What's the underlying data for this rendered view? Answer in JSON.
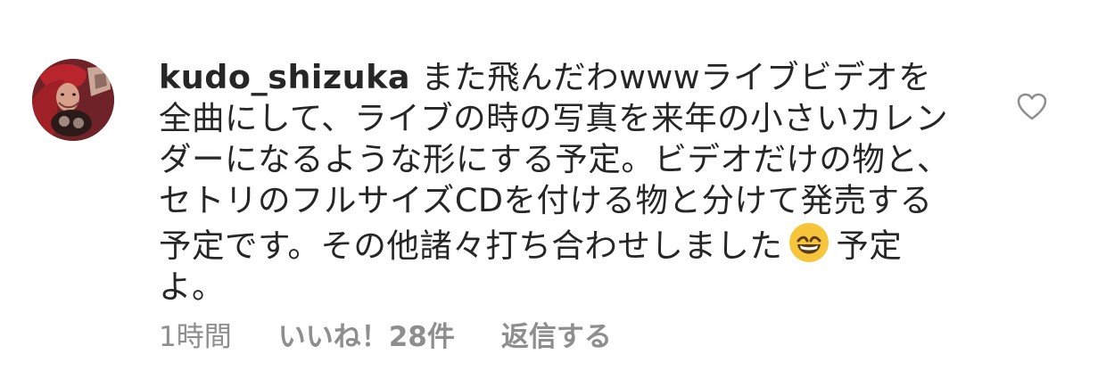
{
  "comment": {
    "username": "kudo_shizuka",
    "text_before_emoji": "また飛んだわwwwライブビデオを全曲にして、ライブの時の写真を来年の小さいカレンダーになるような形にする予定。ビデオだけの物と、セトリのフルサイズCDを付ける物と分けて発売する予定です。その他諸々打ち合わせしました",
    "text_after_emoji": "予定よ。",
    "emoji": "grinning-face-emoji"
  },
  "meta": {
    "time": "1時間",
    "likes": "いいね！28件",
    "reply": "返信する"
  },
  "icons": {
    "heart": "heart-outline-icon",
    "avatar": "profile-avatar"
  },
  "colors": {
    "text": "#262626",
    "muted": "#8e8e8e",
    "emoji_face": "#f7c53a"
  }
}
